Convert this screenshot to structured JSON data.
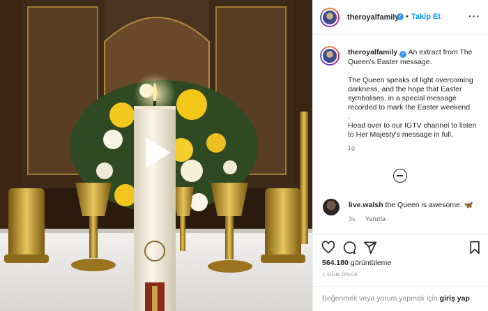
{
  "header": {
    "username": "theroyalfamily",
    "separator": "•",
    "follow_label": "Takip Et",
    "more_label": "···"
  },
  "caption": {
    "username": "theroyalfamily",
    "line1": "An extract from The Queen's Easter message.",
    "dot1": ".",
    "line2": "The Queen speaks of light overcoming darkness, and the hope that Easter symbolises, in a special message recorded to mark the Easter weekend.",
    "dot2": ".",
    "line3": "Head over to our IGTV channel to listen to Her Majesty's message in full.",
    "time": "1g"
  },
  "comment": {
    "username": "live.walsh",
    "text": "the Queen is awesome.",
    "emoji": "🦋",
    "time": "3s",
    "reply_label": "Yanıtla"
  },
  "stats": {
    "views_count": "564.180",
    "views_label": "görüntüleme",
    "date": "1 GÜN ÖNCE"
  },
  "login": {
    "prefix": "Beğenmek veya yorum yapmak için",
    "link": "giriş yap",
    "suffix": "."
  },
  "icons": {
    "like": "heart-icon",
    "comment": "comment-icon",
    "share": "share-icon",
    "save": "bookmark-icon",
    "play": "play-icon",
    "verified": "verified-badge-icon",
    "more": "more-options-icon",
    "load_more": "load-more-comments-icon"
  },
  "colors": {
    "follow": "#0095f6",
    "verified": "#3897f0",
    "muted": "#8e8e8e",
    "text": "#262626"
  }
}
